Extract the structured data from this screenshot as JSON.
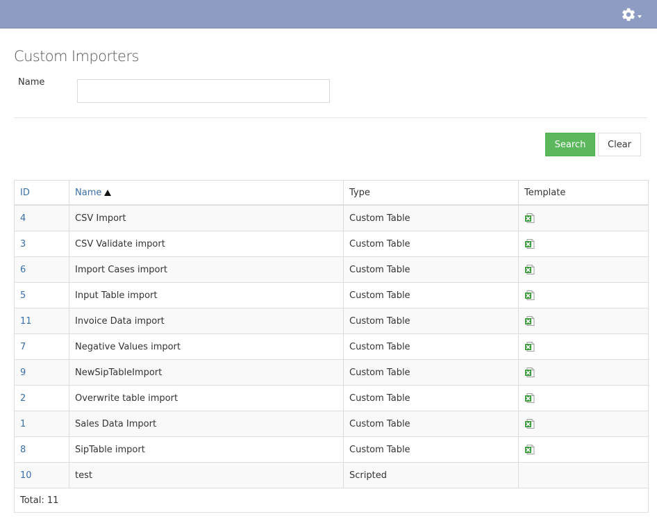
{
  "header": {
    "settings_icon": "gear-icon"
  },
  "page": {
    "title": "Custom Importers"
  },
  "filter": {
    "name_label": "Name",
    "name_value": "",
    "name_placeholder": ""
  },
  "actions": {
    "search_label": "Search",
    "clear_label": "Clear"
  },
  "table": {
    "columns": [
      "ID",
      "Name",
      "Type",
      "Template"
    ],
    "sorted_by": "Name",
    "sort_direction": "ascending",
    "rows": [
      {
        "id": "4",
        "name": "CSV Import",
        "type": "Custom Table",
        "template": "excel-icon"
      },
      {
        "id": "3",
        "name": "CSV Validate import",
        "type": "Custom Table",
        "template": "excel-icon"
      },
      {
        "id": "6",
        "name": "Import Cases import",
        "type": "Custom Table",
        "template": "excel-icon"
      },
      {
        "id": "5",
        "name": "Input Table import",
        "type": "Custom Table",
        "template": "excel-icon"
      },
      {
        "id": "11",
        "name": "Invoice Data import",
        "type": "Custom Table",
        "template": "excel-icon"
      },
      {
        "id": "7",
        "name": "Negative Values import",
        "type": "Custom Table",
        "template": "excel-icon"
      },
      {
        "id": "9",
        "name": "NewSipTableImport",
        "type": "Custom Table",
        "template": "excel-icon"
      },
      {
        "id": "2",
        "name": "Overwrite table import",
        "type": "Custom Table",
        "template": "excel-icon"
      },
      {
        "id": "1",
        "name": "Sales Data Import",
        "type": "Custom Table",
        "template": "excel-icon"
      },
      {
        "id": "8",
        "name": "SipTable import",
        "type": "Custom Table",
        "template": "excel-icon"
      },
      {
        "id": "10",
        "name": "test",
        "type": "Scripted",
        "template": ""
      }
    ],
    "total_label": "Total: 11"
  },
  "colors": {
    "topbar": "#8e9cc3",
    "search_button": "#5cb85c",
    "link": "#3b6ea5"
  }
}
